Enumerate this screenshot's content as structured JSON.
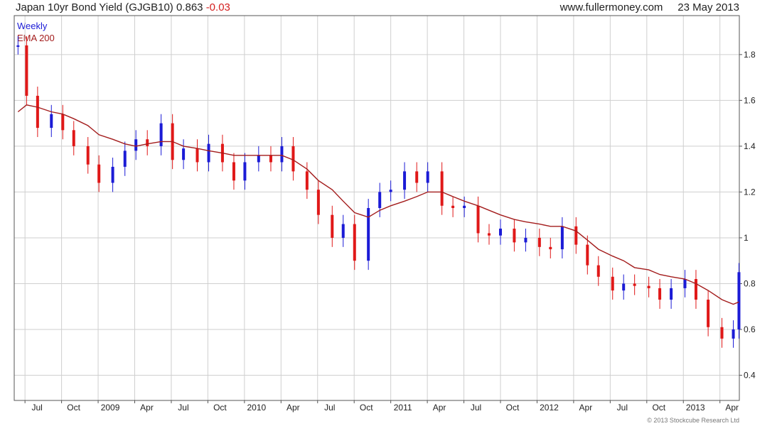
{
  "header": {
    "title": "Japan 10yr Bond Yield (GJGB10)",
    "last": "0.863",
    "change": "-0.03",
    "site": "www.fullermoney.com",
    "date": "23 May 2013"
  },
  "credit": "© 2013 Stockcube Research Ltd",
  "colors": {
    "up": "#1b1bd6",
    "down": "#e01818",
    "ema": "#a31c1c",
    "grid": "#cfcfcf",
    "frame": "#555555"
  },
  "chart_data": {
    "type": "line",
    "x_tick_labels": [
      "Jul",
      "Oct",
      "2009",
      "Apr",
      "Jul",
      "Oct",
      "2010",
      "Apr",
      "Jul",
      "Oct",
      "2011",
      "Apr",
      "Jul",
      "Oct",
      "2012",
      "Apr",
      "Jul",
      "Oct",
      "2013",
      "Apr"
    ],
    "y_ticks": [
      "1.8",
      "1.6",
      "1.4",
      "1.2",
      "1",
      "0.8",
      "0.6",
      "0.4"
    ],
    "ylim": [
      0.29,
      1.97
    ],
    "grid": true,
    "legend_position": "top-left",
    "series": [
      {
        "name": "Weekly",
        "style": "candlestick",
        "x": [
          "2008-06-14",
          "2008-07-05",
          "2008-08-02",
          "2008-09-06",
          "2008-10-04",
          "2008-11-01",
          "2008-12-06",
          "2009-01-03",
          "2009-02-07",
          "2009-03-07",
          "2009-04-04",
          "2009-05-02",
          "2009-06-06",
          "2009-07-04",
          "2009-08-01",
          "2009-09-05",
          "2009-10-03",
          "2009-11-07",
          "2009-12-05",
          "2010-01-02",
          "2010-02-06",
          "2010-03-06",
          "2010-04-03",
          "2010-05-01",
          "2010-06-05",
          "2010-07-03",
          "2010-08-07",
          "2010-09-04",
          "2010-10-02",
          "2010-11-06",
          "2010-12-04",
          "2011-01-01",
          "2011-02-05",
          "2011-03-05",
          "2011-04-02",
          "2011-05-07",
          "2011-06-04",
          "2011-07-02",
          "2011-08-06",
          "2011-09-03",
          "2011-10-01",
          "2011-11-05",
          "2011-12-03",
          "2012-01-07",
          "2012-02-04",
          "2012-03-03",
          "2012-04-07",
          "2012-05-05",
          "2012-06-02",
          "2012-07-07",
          "2012-08-04",
          "2012-09-01",
          "2012-10-06",
          "2012-11-03",
          "2012-12-01",
          "2013-01-05",
          "2013-02-02",
          "2013-03-02",
          "2013-04-06",
          "2013-05-04",
          "2013-05-18"
        ],
        "y": [
          1.84,
          1.62,
          1.48,
          1.54,
          1.47,
          1.4,
          1.32,
          1.24,
          1.31,
          1.38,
          1.43,
          1.4,
          1.5,
          1.34,
          1.39,
          1.33,
          1.41,
          1.33,
          1.25,
          1.33,
          1.36,
          1.33,
          1.4,
          1.29,
          1.21,
          1.1,
          1.0,
          1.06,
          0.9,
          1.13,
          1.2,
          1.21,
          1.29,
          1.24,
          1.29,
          1.14,
          1.13,
          1.14,
          1.02,
          1.01,
          1.04,
          0.98,
          1.0,
          0.96,
          0.95,
          1.05,
          0.97,
          0.88,
          0.83,
          0.77,
          0.8,
          0.79,
          0.78,
          0.73,
          0.78,
          0.82,
          0.73,
          0.61,
          0.56,
          0.6,
          0.85
        ]
      },
      {
        "name": "EMA 200",
        "style": "line",
        "x": [
          "2008-06-14",
          "2008-07-05",
          "2008-08-02",
          "2008-09-06",
          "2008-10-04",
          "2008-11-01",
          "2008-12-06",
          "2009-01-03",
          "2009-02-07",
          "2009-03-07",
          "2009-04-04",
          "2009-05-02",
          "2009-06-06",
          "2009-07-04",
          "2009-08-01",
          "2009-09-05",
          "2009-10-03",
          "2009-11-07",
          "2009-12-05",
          "2010-01-02",
          "2010-02-06",
          "2010-03-06",
          "2010-04-03",
          "2010-05-01",
          "2010-06-05",
          "2010-07-03",
          "2010-08-07",
          "2010-09-04",
          "2010-10-02",
          "2010-11-06",
          "2010-12-04",
          "2011-01-01",
          "2011-02-05",
          "2011-03-05",
          "2011-04-02",
          "2011-05-07",
          "2011-06-04",
          "2011-07-02",
          "2011-08-06",
          "2011-09-03",
          "2011-10-01",
          "2011-11-05",
          "2011-12-03",
          "2012-01-07",
          "2012-02-04",
          "2012-03-03",
          "2012-04-07",
          "2012-05-05",
          "2012-06-02",
          "2012-07-07",
          "2012-08-04",
          "2012-09-01",
          "2012-10-06",
          "2012-11-03",
          "2012-12-01",
          "2013-01-05",
          "2013-02-02",
          "2013-03-02",
          "2013-04-06",
          "2013-05-04",
          "2013-05-18"
        ],
        "y": [
          1.55,
          1.58,
          1.57,
          1.55,
          1.54,
          1.52,
          1.49,
          1.45,
          1.43,
          1.41,
          1.4,
          1.41,
          1.42,
          1.42,
          1.4,
          1.39,
          1.38,
          1.37,
          1.36,
          1.36,
          1.36,
          1.36,
          1.36,
          1.34,
          1.3,
          1.25,
          1.21,
          1.16,
          1.11,
          1.09,
          1.12,
          1.14,
          1.16,
          1.18,
          1.2,
          1.2,
          1.18,
          1.16,
          1.14,
          1.12,
          1.1,
          1.08,
          1.07,
          1.06,
          1.05,
          1.05,
          1.03,
          0.99,
          0.95,
          0.92,
          0.9,
          0.87,
          0.86,
          0.84,
          0.83,
          0.82,
          0.8,
          0.77,
          0.73,
          0.71,
          0.72
        ]
      }
    ]
  }
}
